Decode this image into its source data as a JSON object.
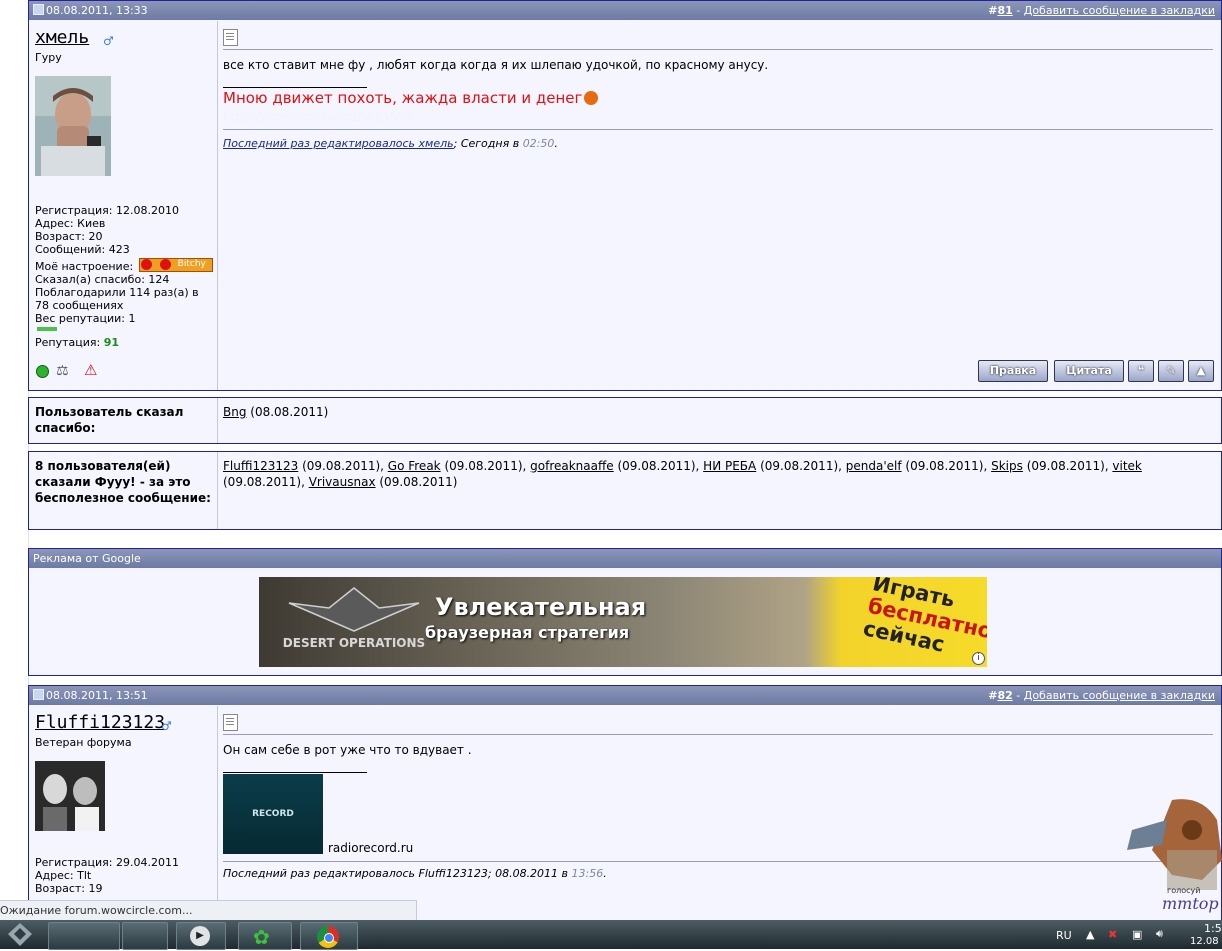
{
  "post81": {
    "date": "08.08.2011, 13:33",
    "num_prefix": "#",
    "num": "81",
    "sep": " - ",
    "bookmark": "Добавить сообщение в закладки",
    "user": {
      "name": "хмель",
      "title": "Гуру",
      "info": [
        "Регистрация: 12.08.2010",
        "Адрес: Киев",
        "Возраст: 20",
        "Сообщений: 423"
      ],
      "mood_label": "Моё настроение:",
      "mood_badge": "Bitchy",
      "info2": [
        "Сказал(а) спасибо: 124",
        "Поблагодарили 114 раз(а) в 78 сообщениях",
        "Вес репутации: 1"
      ],
      "rep_label": "Репутация: ",
      "rep_value": "91"
    },
    "text": "все кто ставит мне фу , любят когда когда я их шлепаю удочкой, по красному анусу.",
    "signature": "Мною движет похоть, жажда власти и денег",
    "sig_link": "http://vkontakte.ru/id13613559",
    "edit_link": "Последний раз редактировалось хмель",
    "edit_rest": "; Сегодня в ",
    "edit_time": "02:50",
    "edit_end": ".",
    "buttons": {
      "edit": "Правка",
      "quote": "Цитата"
    }
  },
  "thanks": {
    "label": "Пользователь сказал спасибо:",
    "user": "Bng",
    "date": " (08.08.2011)"
  },
  "fuu": {
    "label": "8 пользователя(ей) сказали Фууу! - за это бесполезное сообщение:",
    "entries": [
      {
        "user": "Fluffi123123",
        "date": " (09.08.2011), "
      },
      {
        "user": "Go Freak",
        "date": " (09.08.2011), "
      },
      {
        "user": "gofreaknaaffe",
        "date": " (09.08.2011), "
      },
      {
        "user": "НИ РЕБА",
        "date": " (09.08.2011), "
      },
      {
        "user": "penda'elf",
        "date": " (09.08.2011), "
      },
      {
        "user": "Skips",
        "date": " (09.08.2011), "
      },
      {
        "user": "vitek",
        "date": " (09.08.2011), "
      },
      {
        "user": "Vrivausnax",
        "date": " (09.08.2011)"
      }
    ]
  },
  "ad": {
    "header": "Реклама от Google",
    "logo": "DESERT OPERATIONS",
    "line1": "Увлекательная",
    "line2": "браузерная стратегия",
    "cta1": "Играть",
    "cta2": "бесплатно",
    "cta3": "сейчас",
    "info": "i"
  },
  "post82": {
    "date": "08.08.2011, 13:51",
    "num_prefix": "#",
    "num": "82",
    "sep": " - ",
    "bookmark": "Добавить сообщение в закладки",
    "user": {
      "name": "Fluffi123123",
      "title": "Ветеран форума",
      "info": [
        "Регистрация: 29.04.2011",
        "Адрес: Tlt",
        "Возраст: 19"
      ]
    },
    "text": "Он сам себе в рот уже что то вдувает .",
    "sig_image": "RECORD",
    "sig_text": "radiorecord.ru",
    "edit_text": "Последний раз редактировалось Fluffi123123; 08.08.2011 в ",
    "edit_time": "13:56",
    "edit_end": "."
  },
  "status": "Ожидание forum.wowcircle.com...",
  "tray": {
    "lang": "RU",
    "time": "1:5",
    "date": "12.08"
  },
  "promo": "голосуй",
  "promo_logo": "mmtop",
  "colors": {
    "header": "#6d7aa3",
    "border": "#22229c",
    "signature": "#e01010",
    "rep": "#1a8a1a"
  }
}
